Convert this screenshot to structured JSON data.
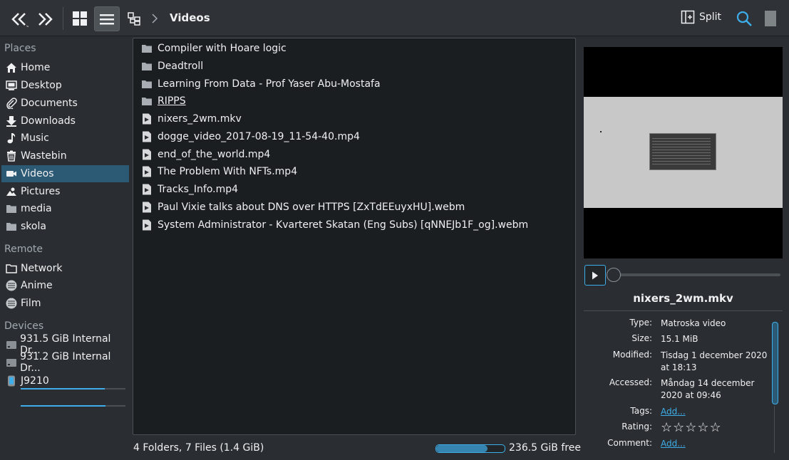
{
  "toolbar": {
    "breadcrumb": "Videos",
    "split_label": "Split"
  },
  "sidebar": {
    "places_header": "Places",
    "places": [
      {
        "label": "Home",
        "icon": "home-icon"
      },
      {
        "label": "Desktop",
        "icon": "desktop-icon"
      },
      {
        "label": "Documents",
        "icon": "paperclip-icon"
      },
      {
        "label": "Downloads",
        "icon": "download-icon"
      },
      {
        "label": "Music",
        "icon": "music-note-icon"
      },
      {
        "label": "Wastebin",
        "icon": "trash-icon"
      },
      {
        "label": "Videos",
        "icon": "video-camera-icon"
      },
      {
        "label": "Pictures",
        "icon": "pictures-icon"
      },
      {
        "label": "media",
        "icon": "folder-icon"
      },
      {
        "label": "skola",
        "icon": "folder-icon"
      }
    ],
    "remote_header": "Remote",
    "remote": [
      {
        "label": "Network",
        "icon": "network-folder-icon"
      },
      {
        "label": "Anime",
        "icon": "disk-icon"
      },
      {
        "label": "Film",
        "icon": "disk-icon"
      }
    ],
    "devices_header": "Devices",
    "devices": [
      {
        "label": "931.5 GiB Internal Dr...",
        "icon": "harddrive-icon",
        "usage": 0.8
      },
      {
        "label": "931.2 GiB Internal Dr...",
        "icon": "harddrive-icon",
        "usage": 0.81
      },
      {
        "label": "J9210",
        "icon": "phone-icon"
      }
    ]
  },
  "files": [
    {
      "name": "Compiler with Hoare logic",
      "type": "folder"
    },
    {
      "name": "Deadtroll",
      "type": "folder"
    },
    {
      "name": "Learning From Data - Prof Yaser Abu-Mostafa",
      "type": "folder"
    },
    {
      "name": "RIPPS",
      "type": "folder"
    },
    {
      "name": "nixers_2wm.mkv",
      "type": "video"
    },
    {
      "name": "dogge_video_2017-08-19_11-54-40.mp4",
      "type": "video"
    },
    {
      "name": "end_of_the_world.mp4",
      "type": "video"
    },
    {
      "name": "The Problem With NFTs.mp4",
      "type": "video"
    },
    {
      "name": "Tracks_Info.mp4",
      "type": "video"
    },
    {
      "name": "Paul Vixie talks about DNS over HTTPS [ZxTdEEuyxHU].webm",
      "type": "video"
    },
    {
      "name": "System Administrator - Kvarteret Skatan (Eng Subs) [qNNEJb1F_og].webm",
      "type": "video"
    }
  ],
  "status": {
    "summary": "4 Folders, 7 Files (1.4 GiB)",
    "free": "236.5 GiB free",
    "used_fraction": 0.75
  },
  "preview": {
    "title": "nixers_2wm.mkv",
    "meta": {
      "type_label": "Type:",
      "type_value": "Matroska video",
      "size_label": "Size:",
      "size_value": "15.1 MiB",
      "modified_label": "Modified:",
      "modified_value_1": "Tisdag 1 december 2020",
      "modified_value_2": "at 18:13",
      "accessed_label": "Accessed:",
      "accessed_value_1": "Måndag 14 december",
      "accessed_value_2": "2020 at 09:46",
      "tags_label": "Tags:",
      "tags_value": "Add...",
      "rating_label": "Rating:",
      "rating_value": "☆☆☆☆☆",
      "comment_label": "Comment:",
      "comment_value": "Add..."
    }
  },
  "colors": {
    "accent": "#3daee9",
    "selection": "#2c5a75",
    "background": "#2a2e32",
    "view": "#1b1e20"
  }
}
